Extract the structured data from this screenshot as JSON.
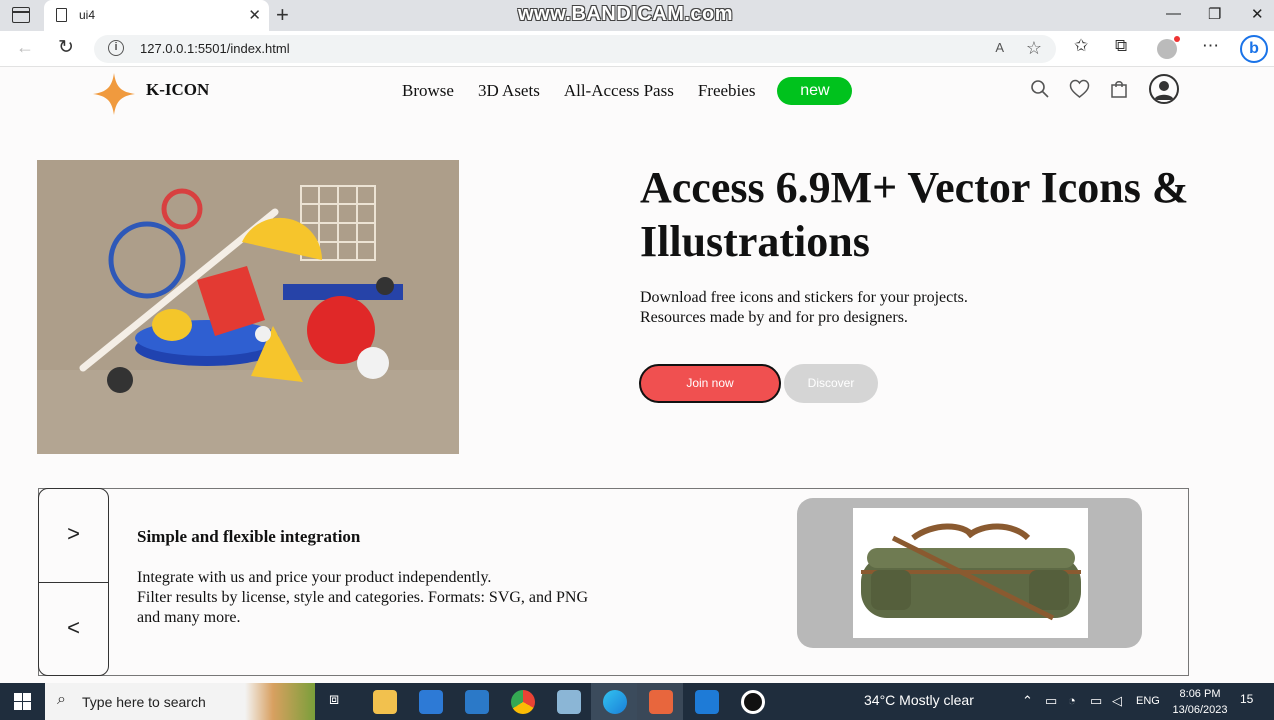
{
  "browser": {
    "tab_title": "ui4",
    "tab_close": "✕",
    "new_tab": "+",
    "watermark": "www.BANDICAM.com",
    "window_minimize": "—",
    "window_maximize": "❐",
    "window_close": "✕",
    "url": "127.0.0.1:5501/index.html",
    "url_info": "i",
    "read_aloud": "A",
    "favorite": "☆"
  },
  "header": {
    "logo_text": "K-ICON",
    "nav": [
      "Browse",
      "3D Asets",
      "All-Access Pass",
      "Freebies"
    ],
    "new_badge": "new"
  },
  "hero": {
    "title": "Access 6.9M+ Vector Icons & Illustrations",
    "subtitle_line1": "Download free icons and stickers for your projects.",
    "subtitle_line2": "Resources made by and for pro designers.",
    "join_label": "Join now",
    "discover_label": "Discover"
  },
  "feature": {
    "next_arrow": ">",
    "prev_arrow": "<",
    "title": "Simple and flexible integration",
    "text_line1": "Integrate with us and price your product independently.",
    "text_line2": "Filter results by license, style and categories. Formats: SVG, and PNG and many more."
  },
  "taskbar": {
    "search_placeholder": "Type here to search",
    "weather": "34°C  Mostly clear",
    "language": "ENG",
    "time": "8:06 PM",
    "date": "13/06/2023",
    "notifications": "15"
  },
  "colors": {
    "accent_green": "#00c21d",
    "join_red": "#f05050",
    "discover_gray": "#d5d5d5",
    "hero_bg": "#ad9e8a",
    "logo_orange": "#f09a3e"
  }
}
